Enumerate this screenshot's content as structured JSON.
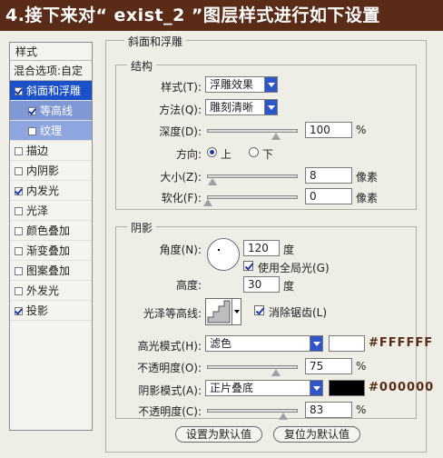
{
  "header": {
    "title": "4.接下来对“ exist_2 ”图层样式进行如下设置"
  },
  "styles_panel": {
    "title": "样式",
    "blend": "混合选项:自定",
    "items": [
      {
        "label": "斜面和浮雕",
        "checked": true
      },
      {
        "label": "等高线",
        "checked": true
      },
      {
        "label": "纹理",
        "checked": false
      },
      {
        "label": "描边",
        "checked": false
      },
      {
        "label": "内阴影",
        "checked": false
      },
      {
        "label": "内发光",
        "checked": true
      },
      {
        "label": "光泽",
        "checked": false
      },
      {
        "label": "颜色叠加",
        "checked": false
      },
      {
        "label": "渐变叠加",
        "checked": false
      },
      {
        "label": "图案叠加",
        "checked": false
      },
      {
        "label": "外发光",
        "checked": false
      },
      {
        "label": "投影",
        "checked": true
      }
    ]
  },
  "bevel": {
    "title": "斜面和浮雕",
    "structure": {
      "title": "结构",
      "style_label": "样式(T):",
      "style_value": "浮雕效果",
      "technique_label": "方法(Q):",
      "technique_value": "雕刻清晰",
      "depth_label": "深度(D):",
      "depth_value": "100",
      "depth_unit": "%",
      "depth_level": 0.75,
      "direction_label": "方向:",
      "direction_up": "上",
      "direction_down": "下",
      "size_label": "大小(Z):",
      "size_value": "8",
      "size_unit": "像素",
      "size_level": 0.05,
      "soften_label": "软化(F):",
      "soften_value": "0",
      "soften_unit": "像素",
      "soften_level": 0.0
    },
    "shading": {
      "title": "阴影",
      "angle_label": "角度(N):",
      "angle_value": "120",
      "angle_unit": "度",
      "global_light_label": "使用全局光(G)",
      "altitude_label": "高度:",
      "altitude_value": "30",
      "altitude_unit": "度",
      "gloss_label": "光泽等高线:",
      "antialias_label": "消除锯齿(L)",
      "highlight_label": "高光模式(H):",
      "highlight_value": "滤色",
      "highlight_color": "#FFFFFF",
      "highlight_hex": "#FFFFFF",
      "highlight_opacity_label": "不透明度(O):",
      "highlight_opacity_value": "75",
      "highlight_opacity_unit": "%",
      "highlight_opacity_level": 0.75,
      "shadow_label": "阴影模式(A):",
      "shadow_value": "正片叠底",
      "shadow_color": "#000000",
      "shadow_hex": "#000000",
      "shadow_opacity_label": "不透明度(C):",
      "shadow_opacity_value": "83",
      "shadow_opacity_unit": "%",
      "shadow_opacity_level": 0.83
    },
    "buttons": {
      "set_default": "设置为默认值",
      "reset_default": "复位为默认值"
    }
  }
}
